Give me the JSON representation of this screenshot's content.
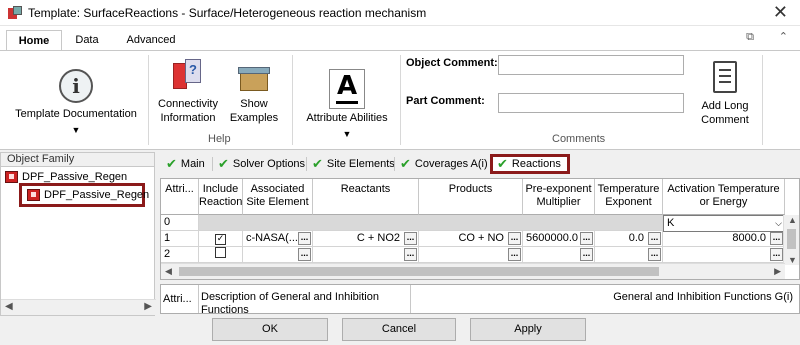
{
  "window": {
    "title": "Template: SurfaceReactions - Surface/Heterogeneous reaction mechanism",
    "close_glyph": "✕"
  },
  "ribbon_tabs": [
    {
      "label": "Home"
    },
    {
      "label": "Data"
    },
    {
      "label": "Advanced"
    }
  ],
  "ribbon": {
    "template_documentation": "Template Documentation",
    "connectivity_line1": "Connectivity",
    "connectivity_line2": "Information",
    "show_line1": "Show",
    "show_line2": "Examples",
    "help_group": "Help",
    "attribute_abilities": "Attribute Abilities",
    "object_comment_label": "Object Comment:",
    "object_comment_value": "",
    "part_comment_label": "Part Comment:",
    "part_comment_value": "",
    "add_long_line1": "Add Long",
    "add_long_line2": "Comment",
    "comments_group": "Comments"
  },
  "left_panel": {
    "header": "Object Family",
    "root": "DPF_Passive_Regen",
    "child": "DPF_Passive_Regen"
  },
  "subtabs": [
    {
      "label": "Main"
    },
    {
      "label": "Solver Options"
    },
    {
      "label": "Site Elements"
    },
    {
      "label": "Coverages A(i)"
    },
    {
      "label": "Reactions"
    }
  ],
  "grid": {
    "headers": [
      "Attri...",
      "Include Reaction",
      "Associated Site Element",
      "Reactants",
      "Products",
      "Pre-exponent Multiplier",
      "Temperature Exponent",
      "Activation Temperature or Energy"
    ],
    "row0": {
      "num": "0",
      "unit": "K"
    },
    "row1": {
      "num": "1",
      "include": "✓",
      "site": "c-NASA(...",
      "reactants": "C + NO2",
      "products": "CO + NO",
      "pre_exp": "5600000.0",
      "temp_exp": "0.0",
      "activation": "8000.0"
    },
    "row2": {
      "num": "2"
    }
  },
  "grid2": {
    "col1": "Attri...",
    "col2": "Description of General and Inhibition Functions",
    "col3": "General and Inhibition Functions G(i)"
  },
  "footer": {
    "ok": "OK",
    "cancel": "Cancel",
    "apply": "Apply"
  }
}
